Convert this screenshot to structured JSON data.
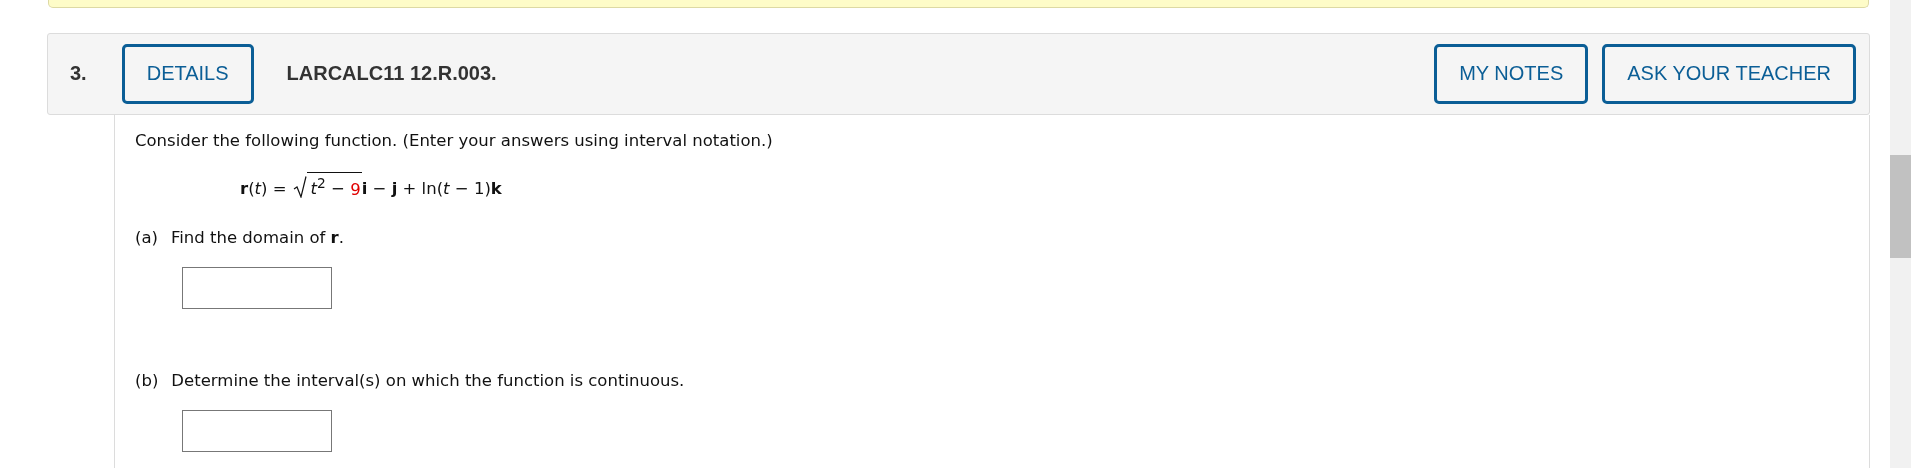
{
  "question": {
    "number": "3.",
    "details_button": "DETAILS",
    "code": "LARCALC11 12.R.003.",
    "buttons": [
      "MY NOTES",
      "ASK YOUR TEACHER"
    ]
  },
  "prompt": "Consider the following function. (Enter your answers using interval notation.)",
  "formula": {
    "lhs": "**r**(*t*) =",
    "radicand": "*t*$^{2}$ −",
    "radicand_value": "9",
    "rest": "**i** − **j** + ln(*t* − 1)**k**"
  },
  "parts": [
    {
      "label": "(a)",
      "text": "Find the domain of **r**."
    },
    {
      "label": "(b)",
      "text": "Determine the interval(s) on which the function is continuous."
    }
  ]
}
